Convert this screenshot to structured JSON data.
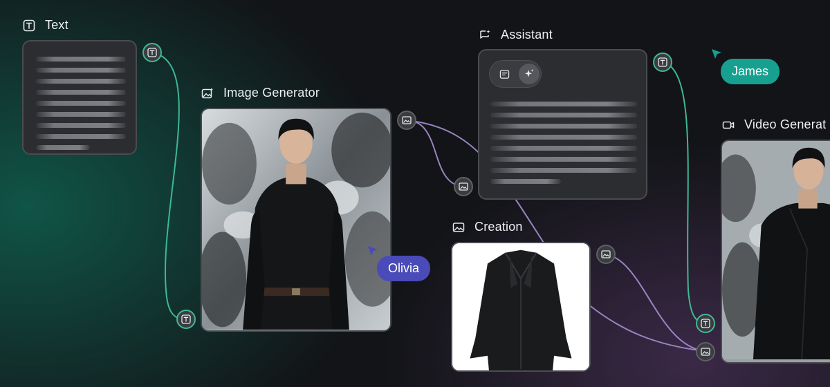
{
  "nodes": {
    "text": {
      "label": "Text",
      "icon": "text-icon"
    },
    "image_generator": {
      "label": "Image Generator",
      "icon": "image-sparkle-icon"
    },
    "assistant": {
      "label": "Assistant",
      "icon": "chat-sparkle-icon"
    },
    "creation": {
      "label": "Creation",
      "icon": "image-icon"
    },
    "video_generator": {
      "label": "Video Generat",
      "icon": "video-icon"
    }
  },
  "collaborators": [
    {
      "name": "Olivia",
      "color": "#4a4ab8"
    },
    {
      "name": "James",
      "color": "#17a08f"
    }
  ],
  "colors": {
    "text_wire": "#3fb893",
    "image_wire": "#9b84c2",
    "card_bg": "#2b2d31",
    "card_border": "#4a4c51"
  }
}
